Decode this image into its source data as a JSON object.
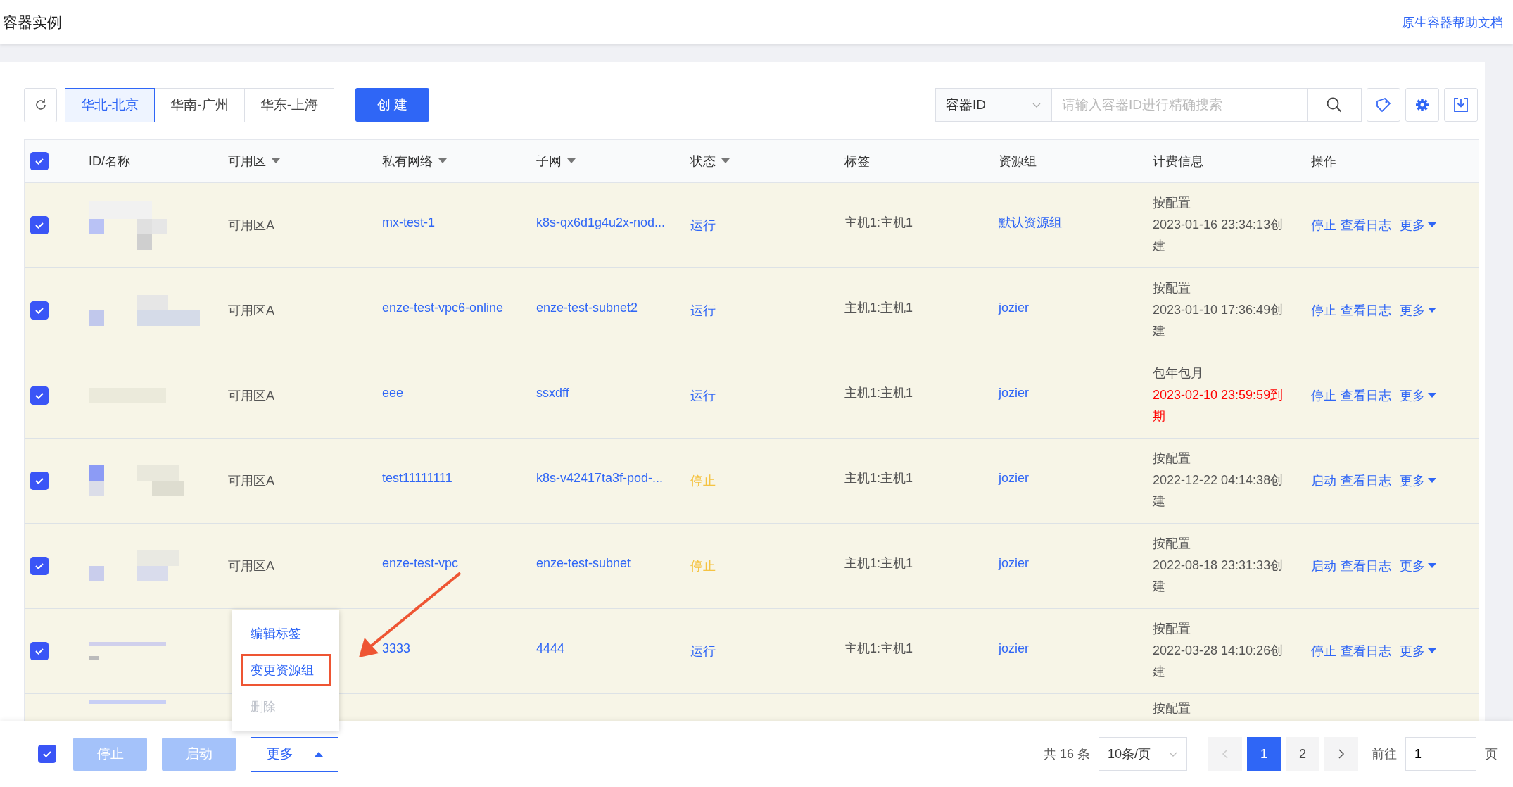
{
  "header": {
    "title": "容器实例",
    "help_link": "原生容器帮助文档"
  },
  "toolbar": {
    "regions": [
      {
        "label": "华北-北京",
        "selected": true
      },
      {
        "label": "华南-广州",
        "selected": false
      },
      {
        "label": "华东-上海",
        "selected": false
      }
    ],
    "create_button": "创 建",
    "search_type": "容器ID",
    "search_placeholder": "请输入容器ID进行精确搜索"
  },
  "table": {
    "all_checked": true,
    "columns": [
      {
        "label": "ID/名称",
        "sortable": false
      },
      {
        "label": "可用区",
        "sortable": true
      },
      {
        "label": "私有网络",
        "sortable": true
      },
      {
        "label": "子网",
        "sortable": true
      },
      {
        "label": "状态",
        "sortable": true
      },
      {
        "label": "标签",
        "sortable": false
      },
      {
        "label": "资源组",
        "sortable": false
      },
      {
        "label": "计费信息",
        "sortable": false
      },
      {
        "label": "操作",
        "sortable": false
      }
    ],
    "rows": [
      {
        "checked": true,
        "zone": "可用区A",
        "vpc": "mx-test-1",
        "subnet": "k8s-qx6d1g4u2x-nod...",
        "status": {
          "text": "运行",
          "color": "#2f66f6"
        },
        "tag": "主机1:主机1",
        "resource_group": "默认资源组",
        "billing_plan": "按配置",
        "billing_time": {
          "text": "2023-01-16 23:34:13创建",
          "color": "#555555"
        },
        "actions": [
          "停止",
          "查看日志",
          "更多"
        ]
      },
      {
        "checked": true,
        "zone": "可用区A",
        "vpc": "enze-test-vpc6-online",
        "subnet": "enze-test-subnet2",
        "status": {
          "text": "运行",
          "color": "#2f66f6"
        },
        "tag": "主机1:主机1",
        "resource_group": "jozier",
        "billing_plan": "按配置",
        "billing_time": {
          "text": "2023-01-10 17:36:49创建",
          "color": "#555555"
        },
        "actions": [
          "停止",
          "查看日志",
          "更多"
        ]
      },
      {
        "checked": true,
        "zone": "可用区A",
        "vpc": "eee",
        "subnet": "ssxdff",
        "status": {
          "text": "运行",
          "color": "#2f66f6"
        },
        "tag": "主机1:主机1",
        "resource_group": "jozier",
        "billing_plan": "包年包月",
        "billing_time": {
          "text": "2023-02-10 23:59:59到期",
          "color": "#ff0000"
        },
        "actions": [
          "停止",
          "查看日志",
          "更多"
        ]
      },
      {
        "checked": true,
        "zone": "可用区A",
        "vpc": "test11111111",
        "subnet": "k8s-v42417ta3f-pod-...",
        "status": {
          "text": "停止",
          "color": "#f5c342"
        },
        "tag": "主机1:主机1",
        "resource_group": "jozier",
        "billing_plan": "按配置",
        "billing_time": {
          "text": "2022-12-22 04:14:38创建",
          "color": "#555555"
        },
        "actions": [
          "启动",
          "查看日志",
          "更多"
        ]
      },
      {
        "checked": true,
        "zone": "可用区A",
        "vpc": "enze-test-vpc",
        "subnet": "enze-test-subnet",
        "status": {
          "text": "停止",
          "color": "#f5c342"
        },
        "tag": "主机1:主机1",
        "resource_group": "jozier",
        "billing_plan": "按配置",
        "billing_time": {
          "text": "2022-08-18 23:31:33创建",
          "color": "#555555"
        },
        "actions": [
          "启动",
          "查看日志",
          "更多"
        ]
      },
      {
        "checked": true,
        "vpc": "3333",
        "subnet": "4444",
        "status": {
          "text": "运行",
          "color": "#2f66f6"
        },
        "tag": "主机1:主机1",
        "resource_group": "jozier",
        "billing_plan": "按配置",
        "billing_time": {
          "text": "2022-03-28 14:10:26创建",
          "color": "#555555"
        },
        "actions": [
          "停止",
          "查看日志",
          "更多"
        ]
      },
      {
        "billing_plan": "按配置"
      }
    ]
  },
  "more_menu": [
    {
      "label": "编辑标签",
      "disabled": false,
      "highlighted": false
    },
    {
      "label": "变更资源组",
      "disabled": false,
      "highlighted": true
    },
    {
      "label": "删除",
      "disabled": true,
      "highlighted": false
    }
  ],
  "bulk_bar": {
    "all_checked": true,
    "buttons": [
      {
        "label": "停止",
        "disabled": true
      },
      {
        "label": "启动",
        "disabled": true
      }
    ],
    "more_button": "更多"
  },
  "pagination": {
    "total": "共 16 条",
    "page_size": "10条/页",
    "pages": [
      {
        "label": "1",
        "selected": true
      },
      {
        "label": "2",
        "selected": false
      }
    ],
    "goto_label": "前往",
    "goto_value": "1",
    "page_suffix": "页"
  }
}
